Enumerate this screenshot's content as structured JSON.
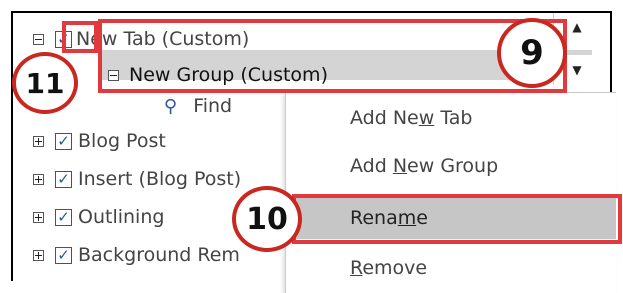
{
  "tree": {
    "root": {
      "label": "New Tab (Custom)",
      "checked": true
    },
    "group": {
      "label": "New Group (Custom)"
    },
    "find_label": "Find",
    "items": [
      {
        "label": "Blog Post",
        "checked": true
      },
      {
        "label": "Insert (Blog Post)",
        "checked": true
      },
      {
        "label": "Outlining",
        "checked": true
      },
      {
        "label": "Background Rem",
        "checked": true
      }
    ]
  },
  "menu": {
    "items": [
      {
        "pre": "Add Ne",
        "acc": "w",
        "post": " Tab",
        "highlighted": false
      },
      {
        "pre": "Add ",
        "acc": "N",
        "post": "ew Group",
        "highlighted": false
      },
      {
        "pre": "Rena",
        "acc": "m",
        "post": "e",
        "highlighted": true
      },
      {
        "pre": "",
        "acc": "R",
        "post": "emove",
        "highlighted": false
      }
    ]
  },
  "callouts": {
    "badge_9": "9",
    "badge_10": "10",
    "badge_11": "11",
    "color": "#e0393e"
  },
  "scroll": {
    "up_glyph": "▲",
    "down_glyph": "▼"
  },
  "check_glyph": "✓",
  "find_icon": "⚲"
}
